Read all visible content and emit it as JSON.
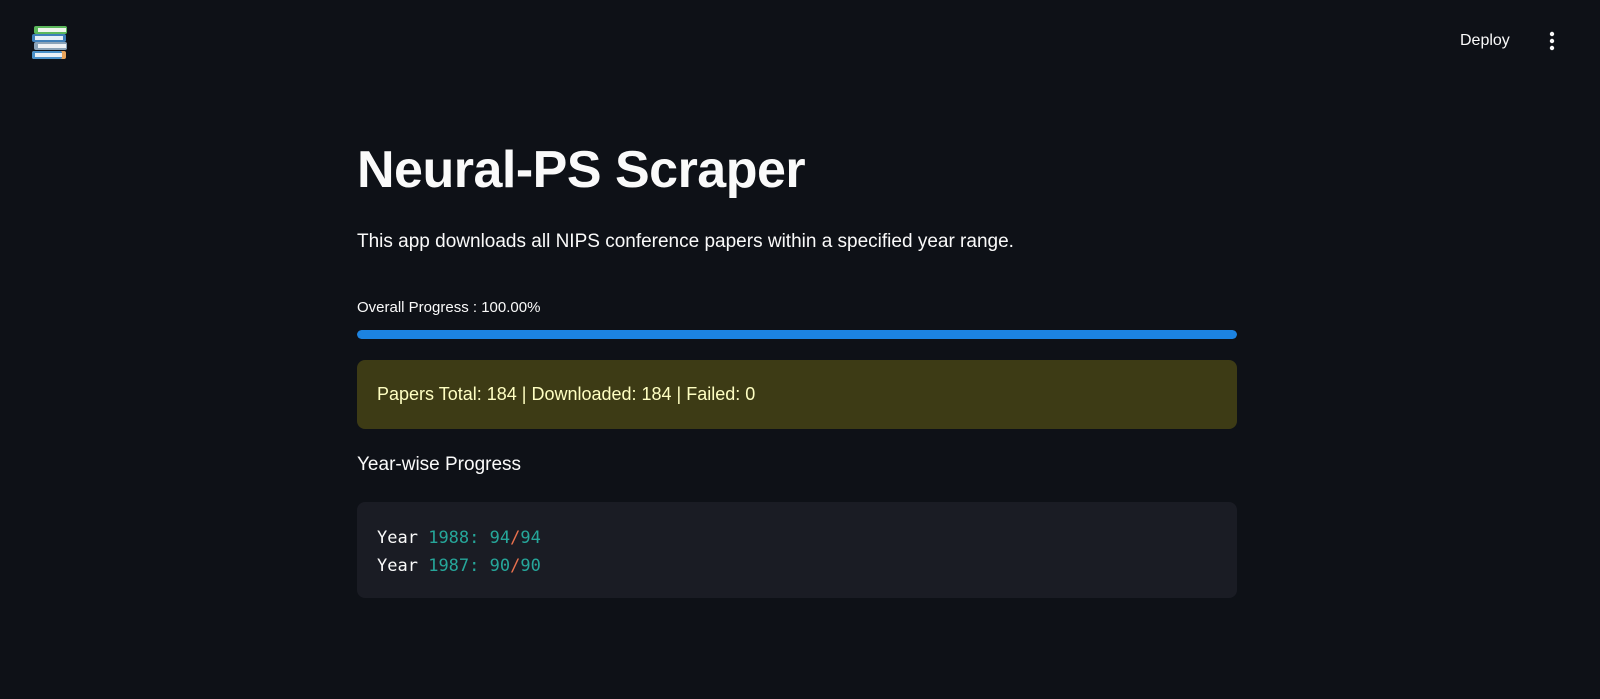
{
  "app": {
    "logo_icon": "books-icon",
    "deploy_label": "Deploy",
    "menu_icon": "vertical-dots-icon"
  },
  "main": {
    "title": "Neural-PS Scraper",
    "description": "This app downloads all NIPS conference papers within a specified year range.",
    "progress": {
      "label": "Overall Progress : 100.00%",
      "value": 1.0,
      "color": "#1c83e1"
    },
    "stats": {
      "text": "Papers Total: 184 | Downloaded: 184 | Failed: 0",
      "background": "#3d3b15",
      "color": "#ffffc2"
    },
    "year_section": {
      "heading": "Year-wise Progress",
      "lines": [
        {
          "keyword": "Year",
          "year": "1988",
          "sep": ":",
          "done": "94",
          "slash": "/",
          "total": "94"
        },
        {
          "keyword": "Year",
          "year": "1987",
          "sep": ":",
          "done": "90",
          "slash": "/",
          "total": "90"
        }
      ],
      "colors": {
        "number": "#26a69a",
        "slash": "#e8704d",
        "keyword": "#fafafa"
      }
    }
  }
}
